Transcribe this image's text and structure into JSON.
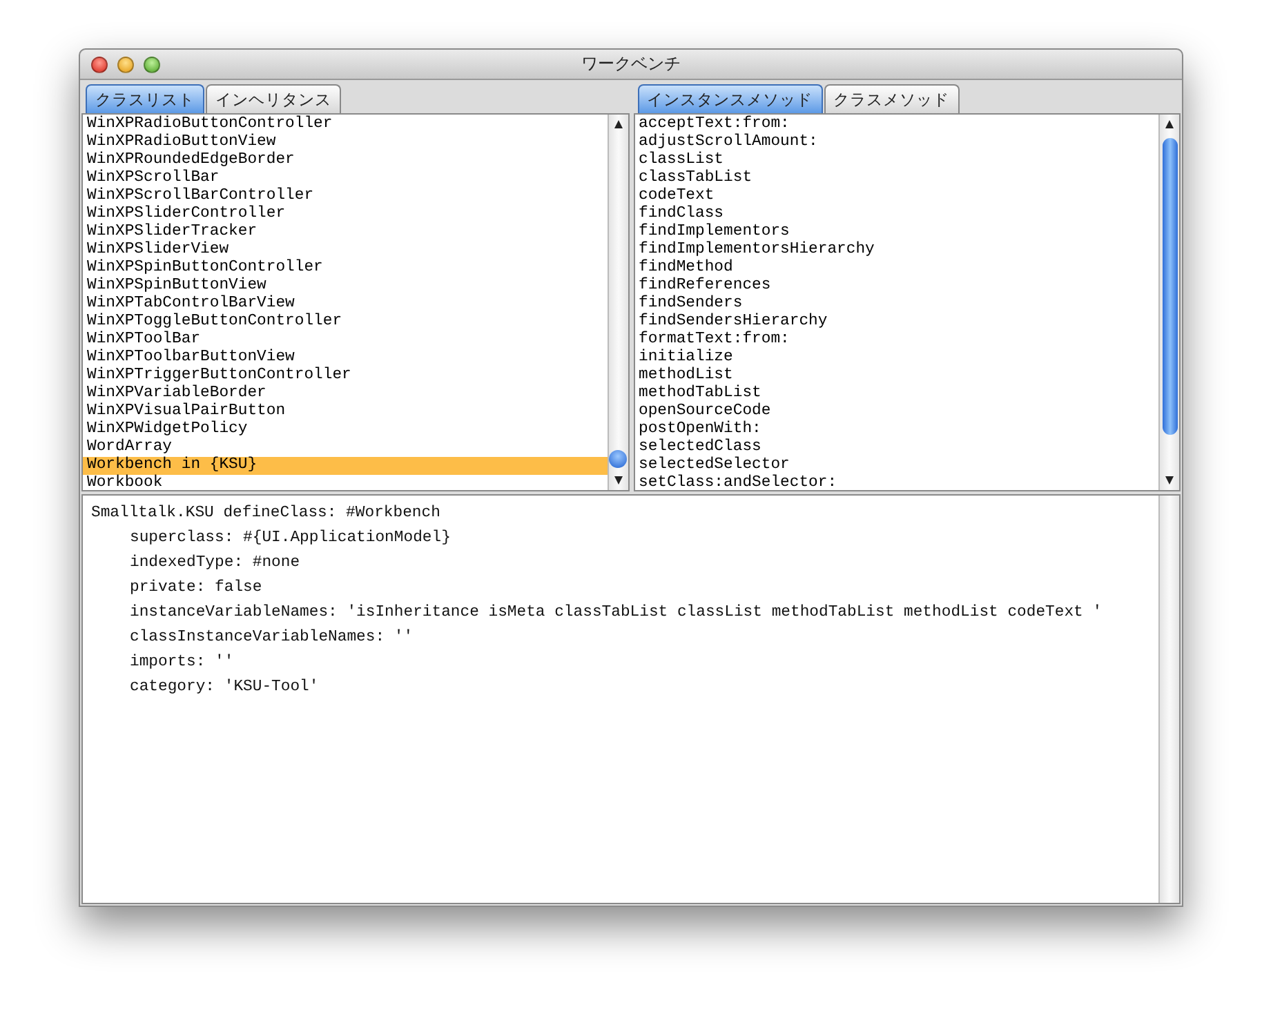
{
  "window": {
    "title": "ワークベンチ"
  },
  "left_tabs": [
    {
      "label": "クラスリスト",
      "selected": true
    },
    {
      "label": "インヘリタンス",
      "selected": false
    }
  ],
  "right_tabs": [
    {
      "label": "インスタンスメソッド",
      "selected": true
    },
    {
      "label": "クラスメソッド",
      "selected": false
    }
  ],
  "class_list": [
    {
      "label": "WinXPRadioButtonController",
      "selected": false
    },
    {
      "label": "WinXPRadioButtonView",
      "selected": false
    },
    {
      "label": "WinXPRoundedEdgeBorder",
      "selected": false
    },
    {
      "label": "WinXPScrollBar",
      "selected": false
    },
    {
      "label": "WinXPScrollBarController",
      "selected": false
    },
    {
      "label": "WinXPSliderController",
      "selected": false
    },
    {
      "label": "WinXPSliderTracker",
      "selected": false
    },
    {
      "label": "WinXPSliderView",
      "selected": false
    },
    {
      "label": "WinXPSpinButtonController",
      "selected": false
    },
    {
      "label": "WinXPSpinButtonView",
      "selected": false
    },
    {
      "label": "WinXPTabControlBarView",
      "selected": false
    },
    {
      "label": "WinXPToggleButtonController",
      "selected": false
    },
    {
      "label": "WinXPToolBar",
      "selected": false
    },
    {
      "label": "WinXPToolbarButtonView",
      "selected": false
    },
    {
      "label": "WinXPTriggerButtonController",
      "selected": false
    },
    {
      "label": "WinXPVariableBorder",
      "selected": false
    },
    {
      "label": "WinXPVisualPairButton",
      "selected": false
    },
    {
      "label": "WinXPWidgetPolicy",
      "selected": false
    },
    {
      "label": "WordArray",
      "selected": false
    },
    {
      "label": "Workbench in {KSU}",
      "selected": true
    },
    {
      "label": "Workbook",
      "selected": false
    }
  ],
  "method_list": [
    {
      "label": "acceptText:from:",
      "selected": false
    },
    {
      "label": "adjustScrollAmount:",
      "selected": false
    },
    {
      "label": "classList",
      "selected": false
    },
    {
      "label": "classTabList",
      "selected": false
    },
    {
      "label": "codeText",
      "selected": false
    },
    {
      "label": "findClass",
      "selected": false
    },
    {
      "label": "findImplementors",
      "selected": false
    },
    {
      "label": "findImplementorsHierarchy",
      "selected": false
    },
    {
      "label": "findMethod",
      "selected": false
    },
    {
      "label": "findReferences",
      "selected": false
    },
    {
      "label": "findSenders",
      "selected": false
    },
    {
      "label": "findSendersHierarchy",
      "selected": false
    },
    {
      "label": "formatText:from:",
      "selected": false
    },
    {
      "label": "initialize",
      "selected": false
    },
    {
      "label": "methodList",
      "selected": false
    },
    {
      "label": "methodTabList",
      "selected": false
    },
    {
      "label": "openSourceCode",
      "selected": false
    },
    {
      "label": "postOpenWith:",
      "selected": false
    },
    {
      "label": "selectedClass",
      "selected": false
    },
    {
      "label": "selectedSelector",
      "selected": false
    },
    {
      "label": "setClass:andSelector:",
      "selected": false
    }
  ],
  "code": [
    {
      "text": "Smalltalk.KSU defineClass: #Workbench",
      "indented": false
    },
    {
      "text": "superclass: #{UI.ApplicationModel}",
      "indented": true
    },
    {
      "text": "indexedType: #none",
      "indented": true
    },
    {
      "text": "private: false",
      "indented": true
    },
    {
      "text": "instanceVariableNames: 'isInheritance isMeta classTabList classList methodTabList methodList codeText '",
      "indented": true
    },
    {
      "text": "classInstanceVariableNames: ''",
      "indented": true
    },
    {
      "text": "imports: ''",
      "indented": true
    },
    {
      "text": "category: 'KSU-Tool'",
      "indented": true
    }
  ]
}
